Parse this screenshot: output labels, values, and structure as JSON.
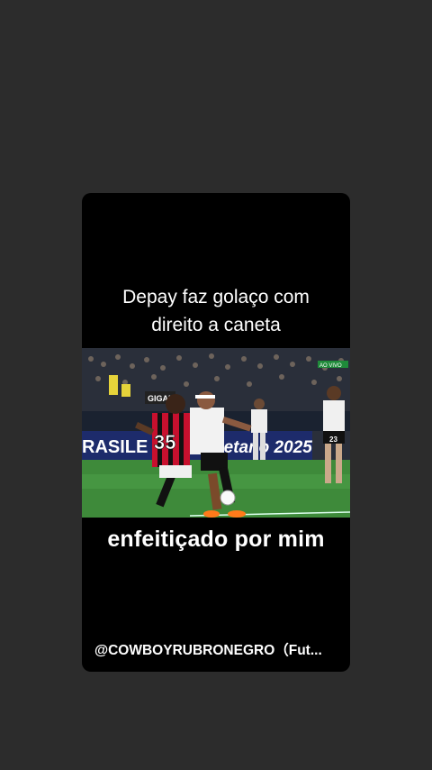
{
  "post": {
    "headline_line1": "Depay faz golaço com",
    "headline_line2": "direito a caneta",
    "caption": "enfeitiçado por mim",
    "attribution": "@COWBOYRUBRONEGRO（Fut..."
  },
  "video": {
    "board_left": "RASILE",
    "board_right": "betano 2025",
    "sign_text": "GIGAN",
    "jersey_number": "35",
    "small_number": "23",
    "broadcast_badge": "AO VIVO"
  },
  "colors": {
    "background": "#2c2c2c",
    "card": "#000000",
    "pitch": "#3e8a3a",
    "board": "#1d2b6b"
  }
}
